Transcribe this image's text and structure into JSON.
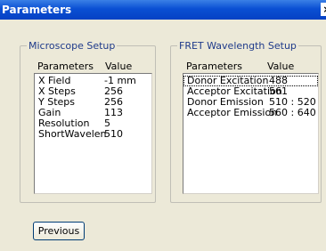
{
  "window": {
    "title": "Parameters",
    "close_glyph": "×"
  },
  "microscope": {
    "legend": "Microscope Setup",
    "col_param": "Parameters",
    "col_value": "Value",
    "rows": [
      {
        "param": "X Field",
        "value": "-1  mm"
      },
      {
        "param": "X Steps",
        "value": "256"
      },
      {
        "param": "Y Steps",
        "value": "256"
      },
      {
        "param": "Gain",
        "value": "113"
      },
      {
        "param": "Resolution",
        "value": "5"
      },
      {
        "param": "ShortWavelen",
        "value": "510"
      }
    ]
  },
  "fret": {
    "legend": "FRET Wavelength Setup",
    "col_param": "Parameters",
    "col_value": "Value",
    "rows": [
      {
        "param": "Donor Excitation",
        "value": "488"
      },
      {
        "param": "Acceptor Excitation",
        "value": "561"
      },
      {
        "param": "Donor Emission",
        "value": "510 : 520"
      },
      {
        "param": "Acceptor Emission",
        "value": "560 : 640"
      }
    ]
  },
  "buttons": {
    "previous": "Previous"
  }
}
